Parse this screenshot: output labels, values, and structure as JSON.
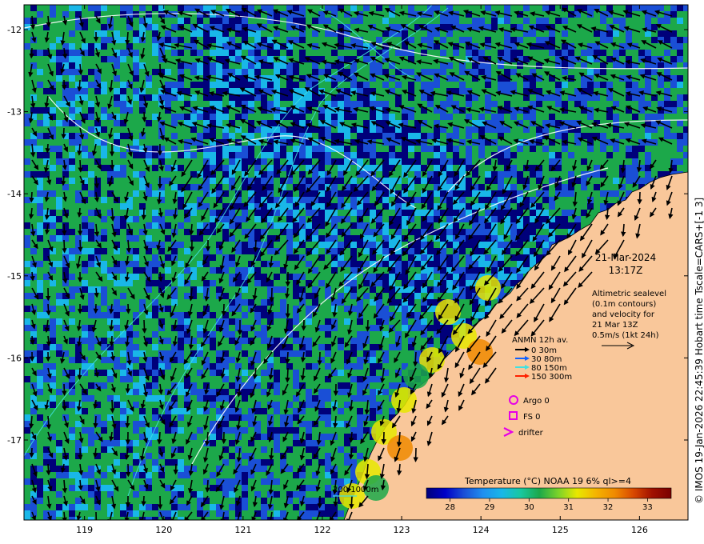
{
  "map": {
    "region": "North-west Australia, Kimberley coast",
    "lon_range": [
      118.6,
      127.0
    ],
    "lat_range": [
      -17.95,
      -11.7
    ],
    "x_ticks": [
      "119",
      "120",
      "121",
      "122",
      "123",
      "124",
      "125",
      "126"
    ],
    "y_ticks": [
      "-12",
      "-13",
      "-14",
      "-15",
      "-16",
      "-17"
    ],
    "colors": {
      "land": "#f9c79a",
      "ocean_deep": "#00007a",
      "ocean_blue": "#1a4fd6",
      "ocean_cyan": "#19b7e8",
      "ocean_green": "#1ca84a",
      "warm_yellow": "#e8e800",
      "warm_orange": "#f08a00",
      "contour": "#ffffff",
      "bathymetry": "#40e0e0",
      "vector": "#000000",
      "argo": "#e600e6"
    }
  },
  "info": {
    "date": "21-Mar-2024",
    "time": "13:17Z",
    "description_lines": [
      "Altimetric sealevel",
      "(0.1m contours)",
      "and velocity for",
      "21 Mar 13Z",
      "0.5m/s (1kt 24h)"
    ]
  },
  "anmn_legend": {
    "title": "ANMN 12h av.",
    "items": [
      {
        "label": "0 30m",
        "color": "#000000"
      },
      {
        "label": "30 80m",
        "color": "#1060ff"
      },
      {
        "label": "80 150m",
        "color": "#40e0e0"
      },
      {
        "label": "150 300m",
        "color": "#ff2000"
      }
    ]
  },
  "platforms": {
    "argo": "Argo 0",
    "fs": "FS 0",
    "drifter": "drifter"
  },
  "bathy_legend": {
    "label": "200  1000m"
  },
  "colorbar": {
    "title": "Temperature (°C) NOAA 19 6% ql>=4",
    "ticks": [
      "28",
      "29",
      "30",
      "31",
      "32",
      "33"
    ],
    "range": [
      27.4,
      33.6
    ],
    "stops": [
      "#00007a",
      "#0000c8",
      "#1a4fd6",
      "#1e8ff0",
      "#19b7e8",
      "#18c8a0",
      "#1ca84a",
      "#7ad22a",
      "#e8e800",
      "#f5b400",
      "#f08a00",
      "#d84800",
      "#a01000",
      "#7a0000"
    ]
  },
  "side_label": "© IMOS 19-Jan-2026 22:45:39 Hobart time Tscale=CARS+[-1 3]"
}
